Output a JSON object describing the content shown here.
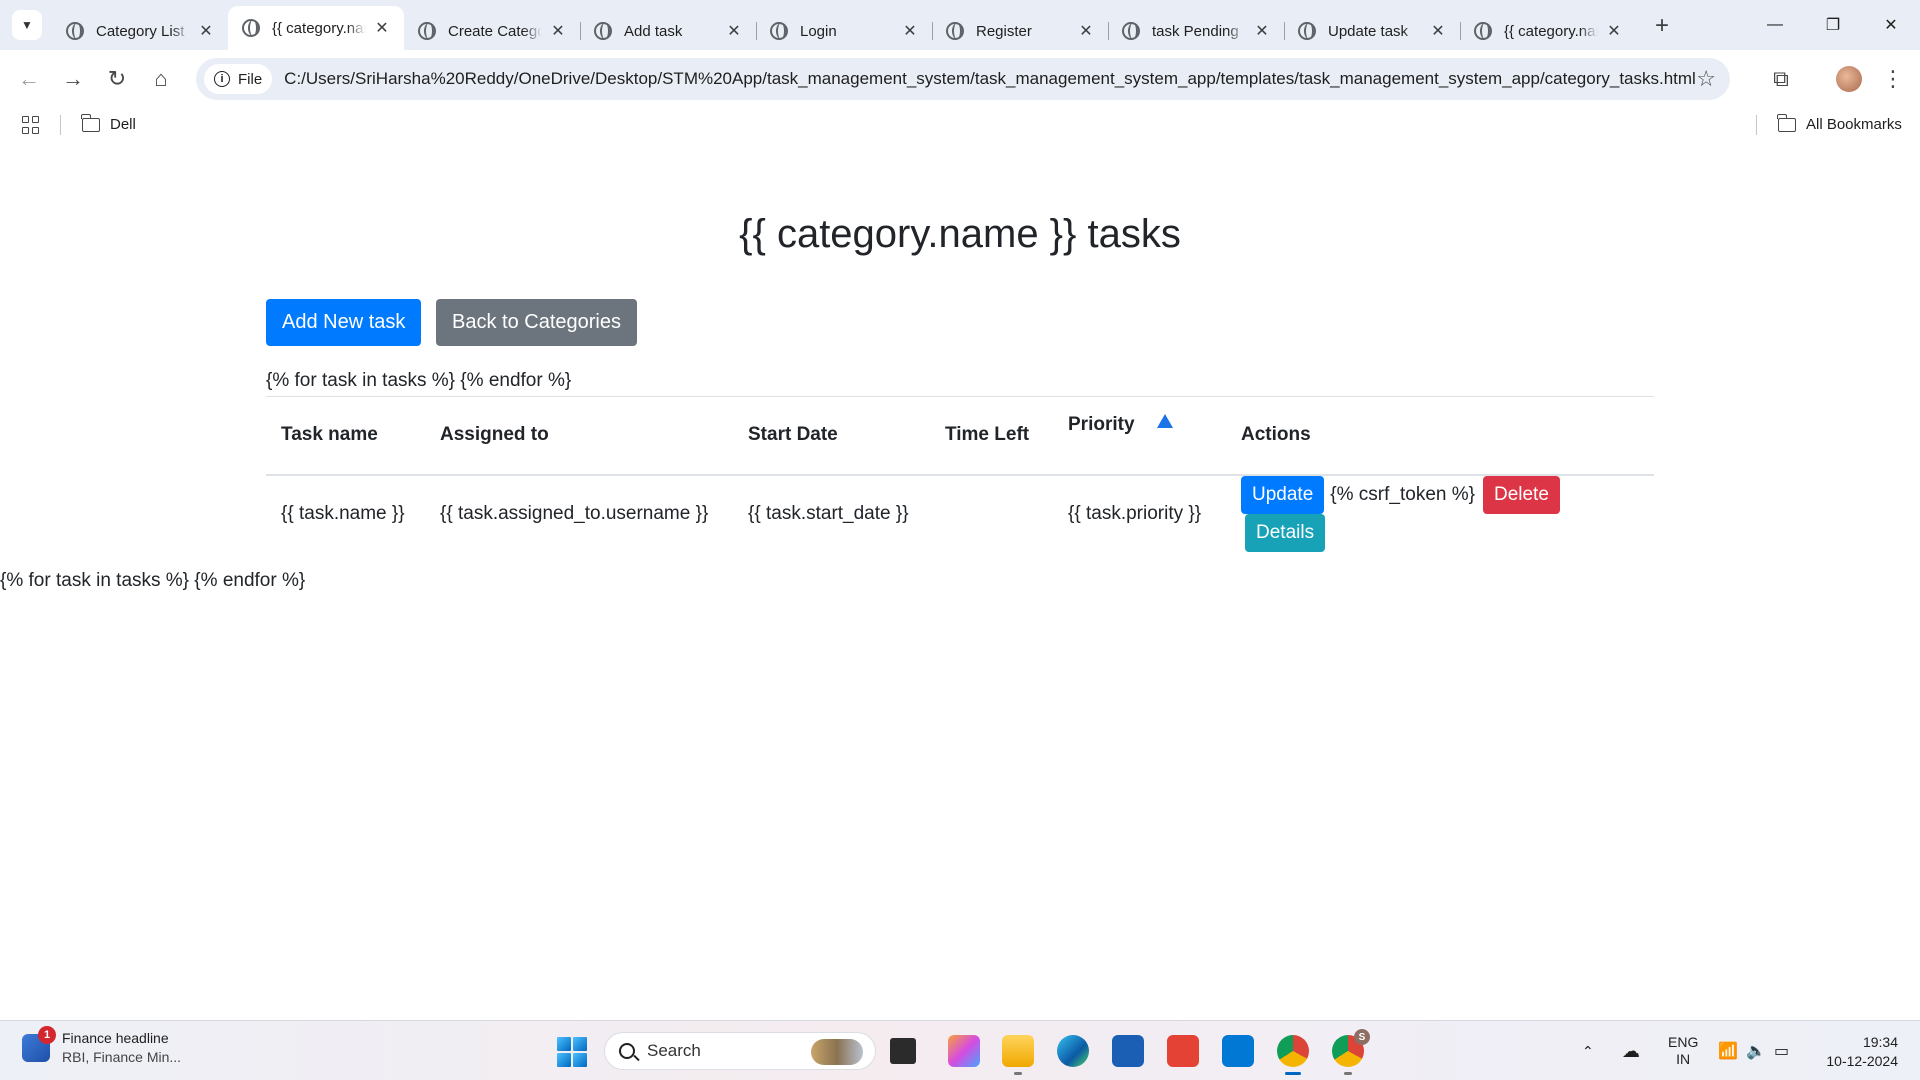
{
  "browser": {
    "tabs": [
      {
        "title": "Category List",
        "active": false
      },
      {
        "title": "{{ category.name }} tasks",
        "active": true
      },
      {
        "title": "Create Category",
        "active": false
      },
      {
        "title": "Add task",
        "active": false
      },
      {
        "title": "Login",
        "active": false
      },
      {
        "title": "Register",
        "active": false
      },
      {
        "title": "task Pending",
        "active": false
      },
      {
        "title": "Update task",
        "active": false
      },
      {
        "title": "{{ category.name }} tasks",
        "active": false
      }
    ],
    "close_glyph": "✕",
    "new_tab_glyph": "+",
    "window_controls": {
      "minimize": "—",
      "restore": "❐",
      "close": "✕"
    },
    "site_chip": "File",
    "url": "C:/Users/SriHarsha%20Reddy/OneDrive/Desktop/STM%20App/task_management_system/task_management_system_app/templates/task_management_system_app/category_tasks.html",
    "nav_icons": {
      "back": "←",
      "forward": "→",
      "reload": "↻",
      "home": "⌂",
      "star": "☆",
      "extensions": "⧉",
      "menu": "⋮"
    }
  },
  "bookmarks": {
    "items": [
      {
        "label": "Dell"
      }
    ],
    "all_bookmarks": "All Bookmarks"
  },
  "page": {
    "title": "{{ category.name }} tasks",
    "add_button": "Add New task",
    "back_button": "Back to Categories",
    "loop_text_top": "{% for task in tasks %} {% endfor %}",
    "loop_text_bottom": "{% for task in tasks %} {% endfor %}",
    "table": {
      "headers": [
        "Task name",
        "Assigned to",
        "Start Date",
        "Time Left",
        "Priority",
        "Actions"
      ],
      "rows": [
        {
          "name": "{{ task.name }}",
          "assigned_to": "{{ task.assigned_to.username }}",
          "start_date": "{{ task.start_date }}",
          "time_left": "",
          "priority": "{{ task.priority }}",
          "actions": {
            "update": "Update",
            "csrf": "{% csrf_token %}",
            "delete": "Delete",
            "details": "Details"
          }
        }
      ]
    }
  },
  "taskbar": {
    "news_badge": "1",
    "news_title": "Finance headline",
    "news_sub": "RBI, Finance Min...",
    "search_placeholder": "Search",
    "language_line1": "ENG",
    "language_line2": "IN",
    "time": "19:34",
    "date": "10-12-2024",
    "chrome_badge": "S"
  },
  "colors": {
    "primary": "#007bff",
    "secondary": "#6c757d",
    "danger": "#dc3545",
    "info": "#17a2b8",
    "sort_arrow": "#1a73e8"
  }
}
